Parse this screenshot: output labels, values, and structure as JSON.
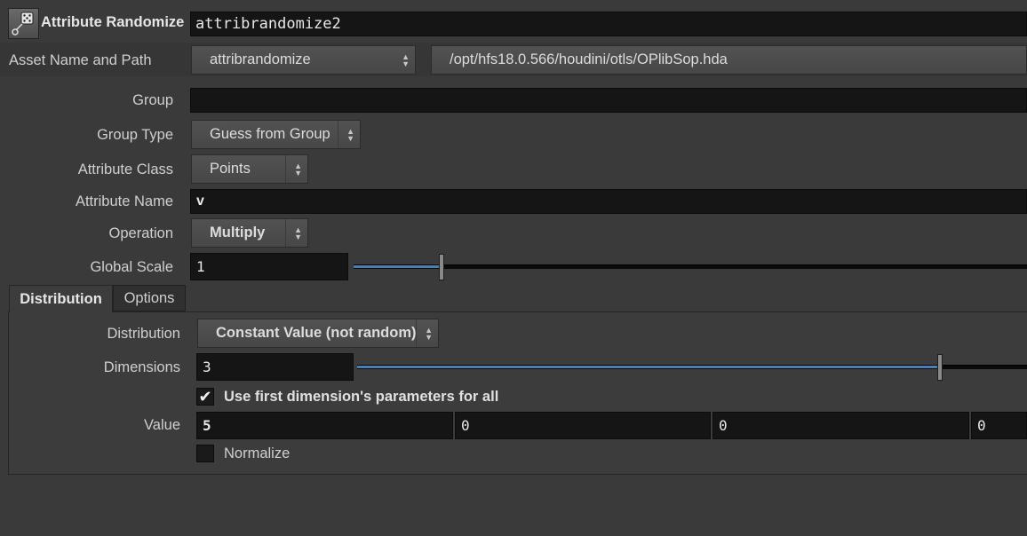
{
  "header": {
    "node_type": "Attribute Randomize",
    "node_name": "attribrandomize2",
    "icon": "dice-icon"
  },
  "asset": {
    "label": "Asset Name and Path",
    "name": "attribrandomize",
    "path": "/opt/hfs18.0.566/houdini/otls/OPlibSop.hda"
  },
  "params": {
    "group": {
      "label": "Group",
      "value": ""
    },
    "group_type": {
      "label": "Group Type",
      "value": "Guess from Group"
    },
    "attribute_class": {
      "label": "Attribute Class",
      "value": "Points"
    },
    "attribute_name": {
      "label": "Attribute Name",
      "value": "v"
    },
    "operation": {
      "label": "Operation",
      "value": "Multiply"
    },
    "global_scale": {
      "label": "Global Scale",
      "value": "1",
      "slider_fraction": 0.13
    }
  },
  "tabs": [
    {
      "label": "Distribution",
      "active": true
    },
    {
      "label": "Options",
      "active": false
    }
  ],
  "distribution": {
    "distribution": {
      "label": "Distribution",
      "value": "Constant Value (not random)"
    },
    "dimensions": {
      "label": "Dimensions",
      "value": "3",
      "slider_fraction": 0.87
    },
    "use_first": {
      "label": "Use first dimension's parameters for all",
      "checked": true
    },
    "value": {
      "label": "Value",
      "values": [
        "5",
        "0",
        "0",
        "0"
      ]
    },
    "normalize": {
      "label": "Normalize",
      "checked": false
    }
  },
  "colors": {
    "background": "#3a3a3a",
    "field": "#151515",
    "slider_accent": "#4a7fb5"
  }
}
